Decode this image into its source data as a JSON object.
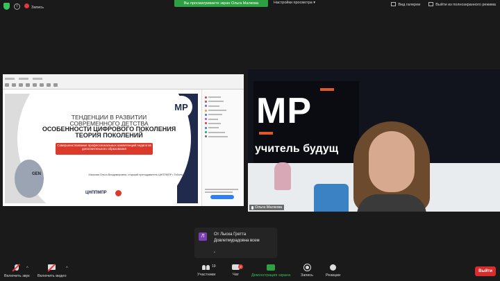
{
  "topbar": {
    "record_label": "Запись",
    "share_banner": "Вы просматриваете экран Ольга Малкова",
    "view_options": "Настройки просмотра",
    "gallery_label": "Вид галереи",
    "exit_fullscreen": "Выйти из полноэкранного режима"
  },
  "slide": {
    "line1": "ТЕНДЕНЦИИ В РАЗВИТИИ СОВРЕМЕННОГО ДЕТСТВА",
    "line2": "ОСОБЕННОСТИ ЦИФРОВОГО ПОКОЛЕНИЯ ТЕОРИЯ ПОКОЛЕНИЙ",
    "red_box": "Совершенствование профессиональных компетенций педагогов дополнительного образования",
    "author": "Малкова Ольга Владимировна, старший преподаватель ЦНППМПР г.Тобольск",
    "org": "ЦНППМПР",
    "logo": "MP",
    "gen_label": "GEN"
  },
  "camera": {
    "logo": "MP",
    "wall_text": "учитель будущ",
    "name": "Ольга Малкова"
  },
  "chat_popup": {
    "avatar": "Л",
    "text": "От Лыска Гретта Довлетмурадовна всем",
    "ellipsis": "•"
  },
  "toolbar": {
    "unmute": "Включить звук",
    "start_video": "Включить видео",
    "participants": "Участники",
    "participants_count": "19",
    "chat": "Чат",
    "chat_badge": "2",
    "share": "Демонстрация экрана",
    "record": "Запись",
    "reactions": "Реакции",
    "end": "Выйти"
  },
  "colors": {
    "share_green": "#2ea043",
    "end_red": "#d92d2d",
    "slide_red": "#d93a2b",
    "slide_navy": "#1f2a4d"
  }
}
